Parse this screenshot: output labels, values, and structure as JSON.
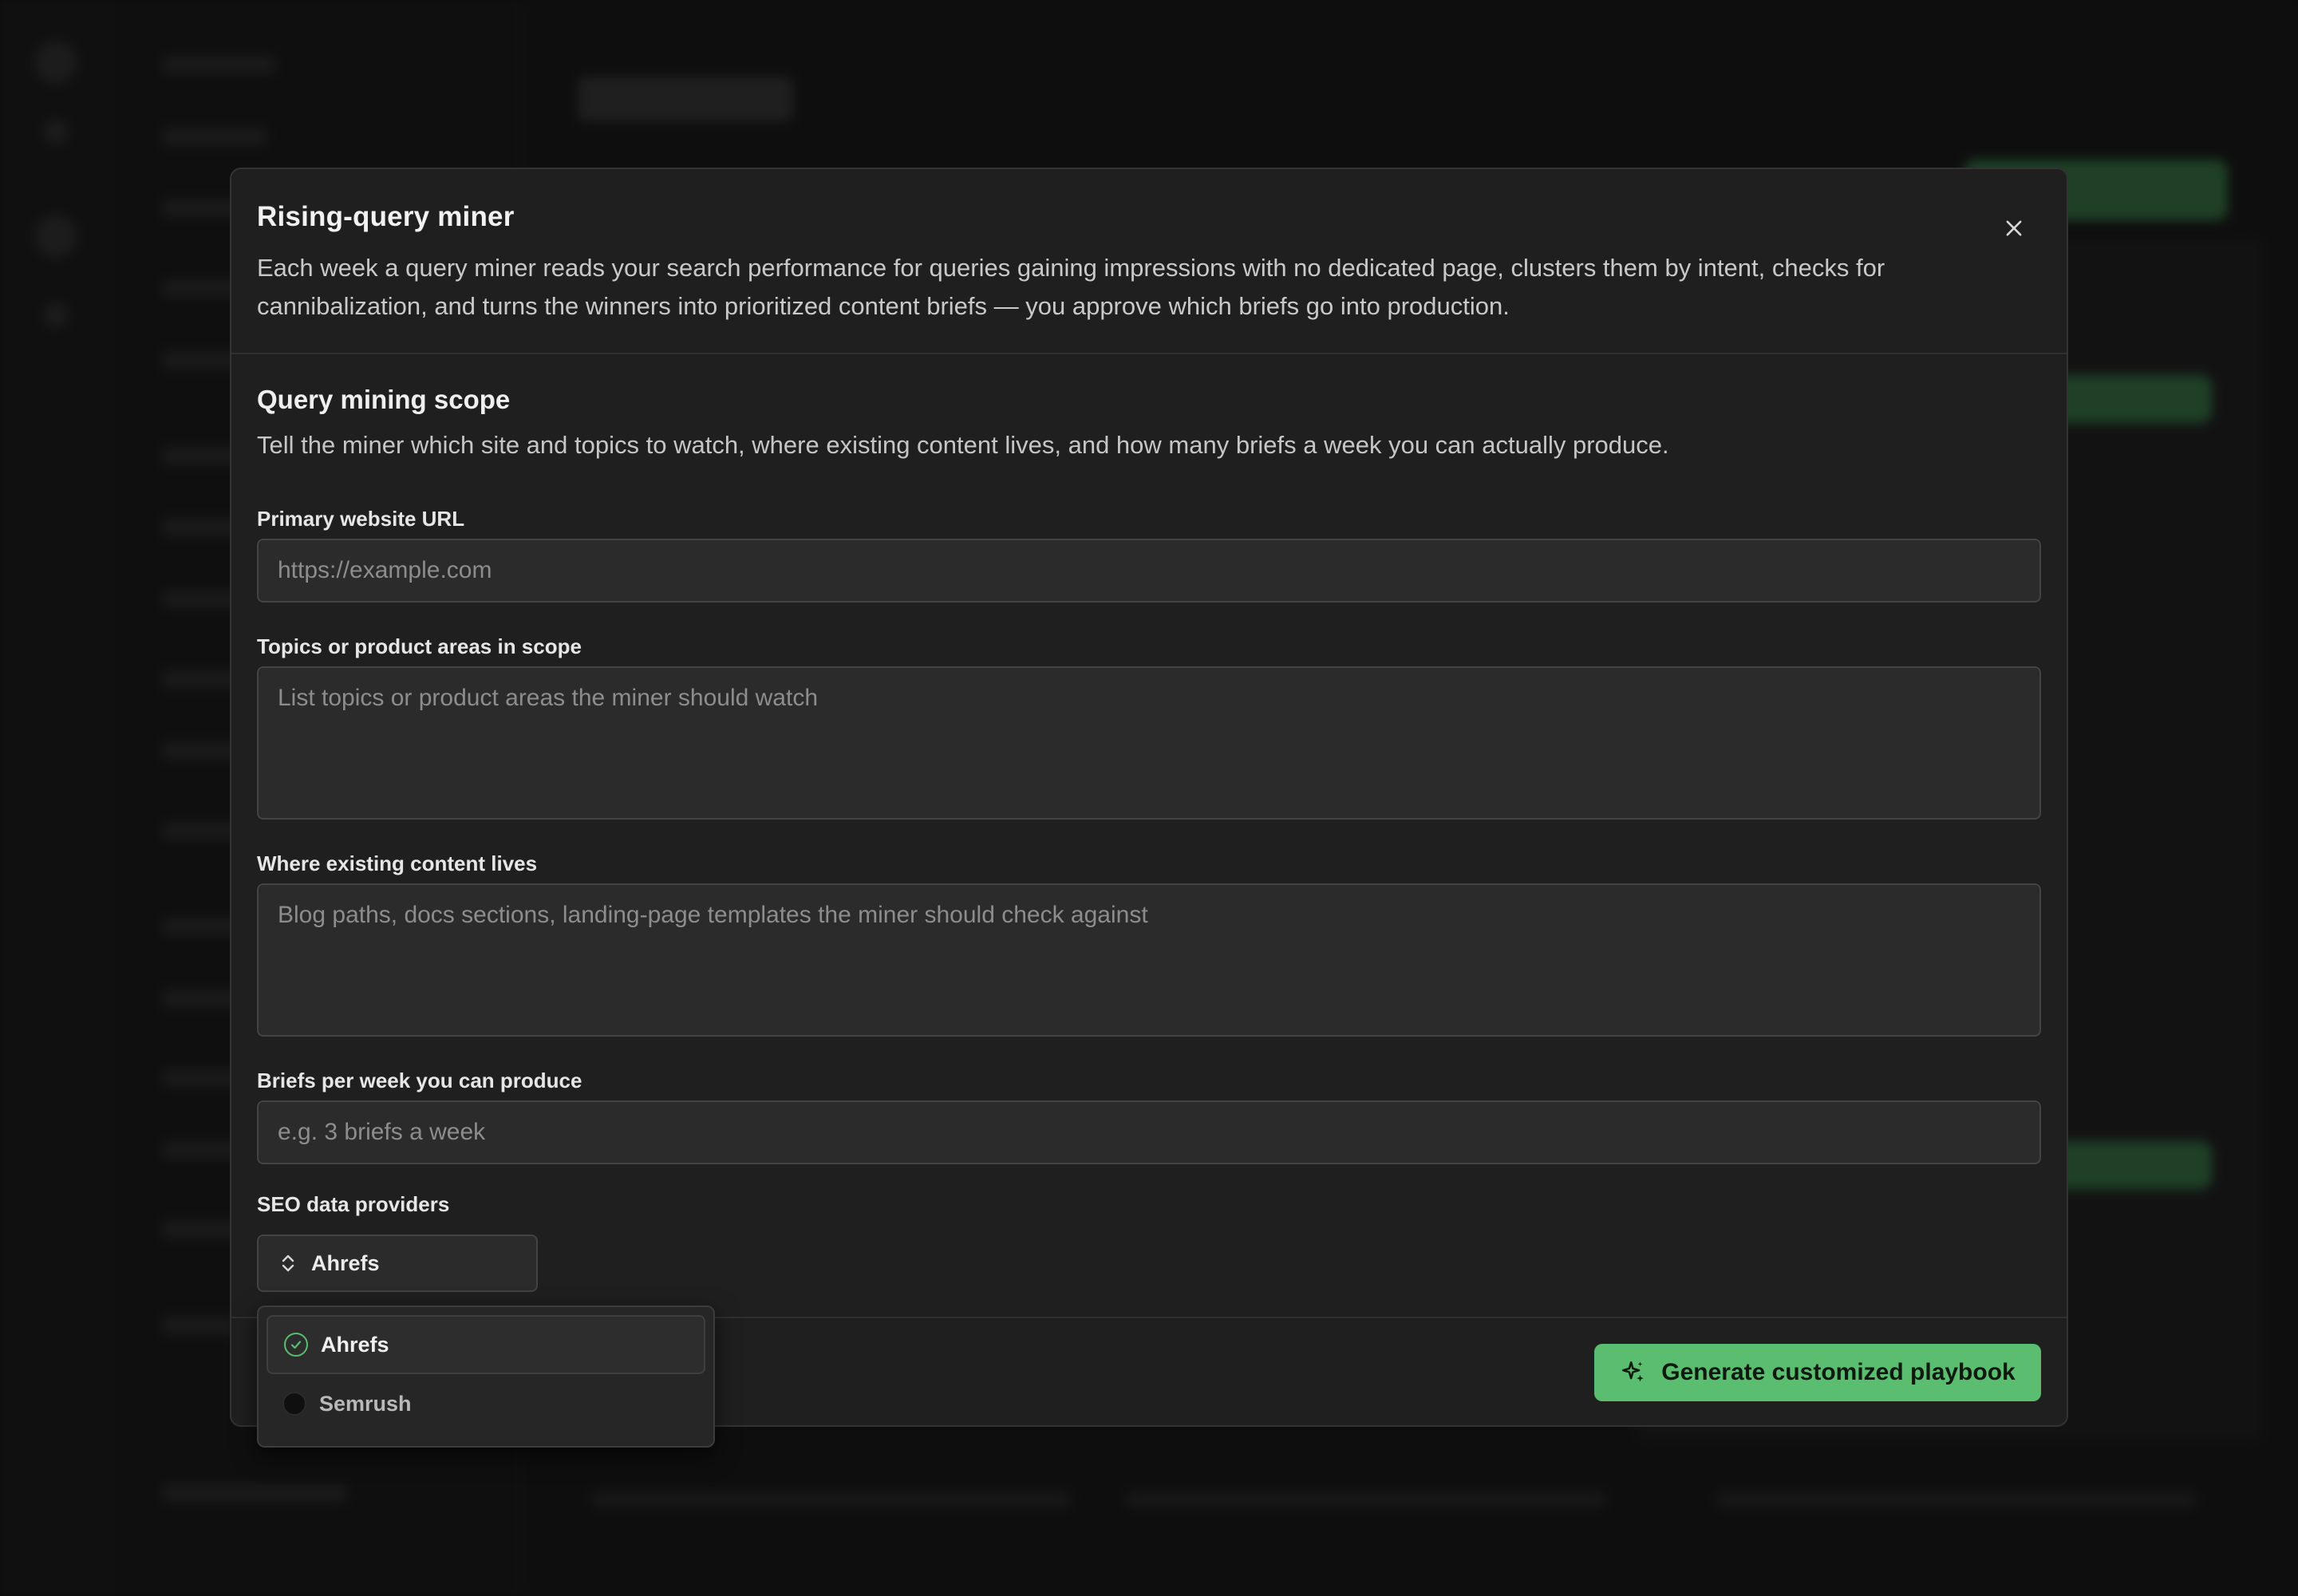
{
  "modal": {
    "title": "Rising-query miner",
    "description": "Each week a query miner reads your search performance for queries gaining impressions with no dedicated page, clusters them by intent, checks for cannibalization, and turns the winners into prioritized content briefs — you approve which briefs go into production."
  },
  "scope": {
    "title": "Query mining scope",
    "description": "Tell the miner which site and topics to watch, where existing content lives, and how many briefs a week you can actually produce."
  },
  "fields": {
    "website": {
      "label": "Primary website URL",
      "placeholder": "https://example.com",
      "value": ""
    },
    "topics": {
      "label": "Topics or product areas in scope",
      "placeholder": "List topics or product areas the miner should watch",
      "value": ""
    },
    "content": {
      "label": "Where existing content lives",
      "placeholder": "Blog paths, docs sections, landing-page templates the miner should check against",
      "value": ""
    },
    "briefs": {
      "label": "Briefs per week you can produce",
      "placeholder": "e.g. 3 briefs a week",
      "value": ""
    }
  },
  "providers": {
    "label": "SEO data providers",
    "selected": "Ahrefs",
    "options": [
      {
        "name": "Ahrefs",
        "checked": true
      },
      {
        "name": "Semrush",
        "checked": false
      }
    ]
  },
  "cta": {
    "label": "Generate customized playbook"
  },
  "colors": {
    "accent": "#5bbd6f",
    "modal_bg": "#1f1f1f",
    "field_bg": "#2b2b2b"
  },
  "icons": {
    "close": "close-icon",
    "select": "chevron-up-down-icon",
    "cta": "sparkles-icon",
    "check": "check-circle-icon"
  }
}
